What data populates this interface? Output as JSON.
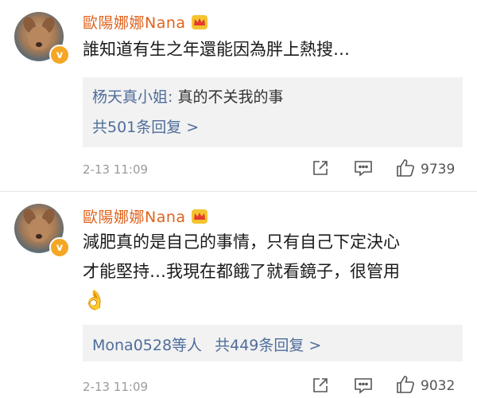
{
  "comments": [
    {
      "username": "歐陽娜娜Nana",
      "text": "誰知道有生之年還能因為胖上熱搜…",
      "reply_author": "杨天真小姐:",
      "reply_text": "真的不关我的事",
      "reply_count": "共501条回复 >",
      "time": "2-13 11:09",
      "likes": "9739"
    },
    {
      "username": "歐陽娜娜Nana",
      "text_line1": "減肥真的是自己的事情，只有自己下定決心",
      "text_line2": "才能堅持…我現在都餓了就看鏡子，很管用",
      "emoji": "👌",
      "reply_users": "Mona0528等人",
      "reply_count": "共449条回复 >",
      "time": "2-13 11:09",
      "likes": "9032"
    }
  ],
  "badge_label": "v",
  "icons": [
    "share-icon",
    "comment-icon",
    "like-icon",
    "crown-icon"
  ],
  "colors": {
    "username": "#e0641e",
    "link": "#4f6d9b",
    "reply_bg": "#f2f2f2",
    "time": "#9a9a9a",
    "badge": "#f5a623"
  }
}
